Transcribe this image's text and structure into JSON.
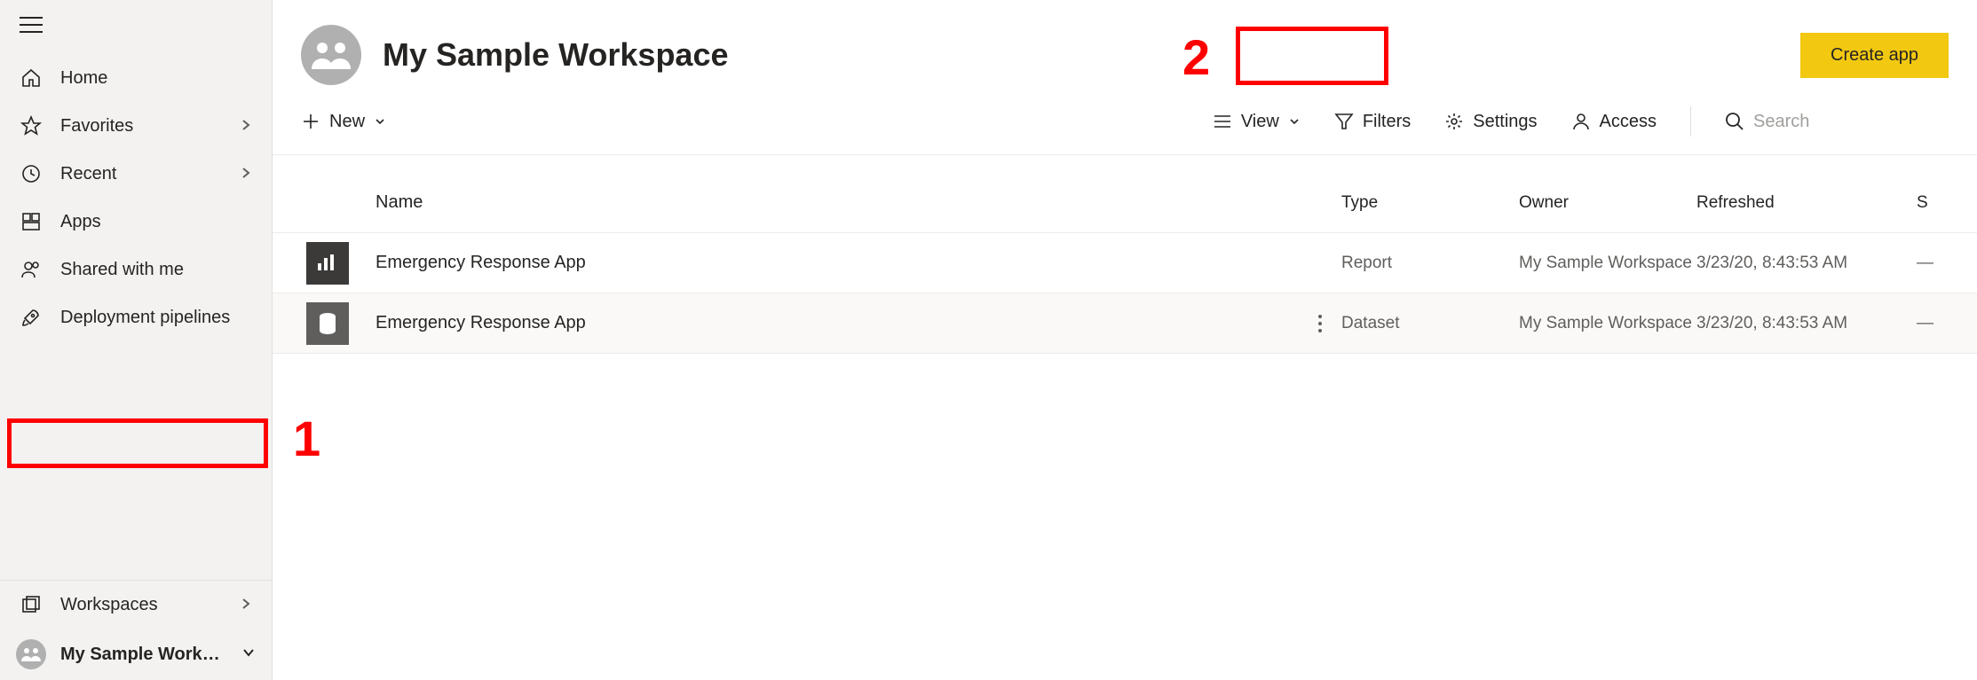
{
  "sidebar": {
    "items": [
      {
        "label": "Home",
        "icon": "home",
        "chevron": false
      },
      {
        "label": "Favorites",
        "icon": "star",
        "chevron": true
      },
      {
        "label": "Recent",
        "icon": "clock",
        "chevron": true
      },
      {
        "label": "Apps",
        "icon": "apps",
        "chevron": false
      },
      {
        "label": "Shared with me",
        "icon": "people",
        "chevron": false
      },
      {
        "label": "Deployment pipelines",
        "icon": "rocket",
        "chevron": false
      }
    ],
    "workspaces_label": "Workspaces",
    "current_workspace_label": "My Sample Works…"
  },
  "header": {
    "title": "My Sample Workspace",
    "create_app_label": "Create app"
  },
  "toolbar": {
    "new_label": "New",
    "view_label": "View",
    "filters_label": "Filters",
    "settings_label": "Settings",
    "access_label": "Access",
    "search_placeholder": "Search"
  },
  "table": {
    "columns": {
      "name": "Name",
      "type": "Type",
      "owner": "Owner",
      "refreshed": "Refreshed",
      "sensitivity": "S"
    },
    "rows": [
      {
        "icon": "report",
        "name": "Emergency Response App",
        "type": "Report",
        "owner": "My Sample Workspace",
        "refreshed": "3/23/20, 8:43:53 AM",
        "sensitivity": "—",
        "hover": false
      },
      {
        "icon": "dataset",
        "name": "Emergency Response App",
        "type": "Dataset",
        "owner": "My Sample Workspace",
        "refreshed": "3/23/20, 8:43:53 AM",
        "sensitivity": "—",
        "hover": true
      }
    ]
  },
  "annotations": {
    "label1": "1",
    "label2": "2"
  }
}
